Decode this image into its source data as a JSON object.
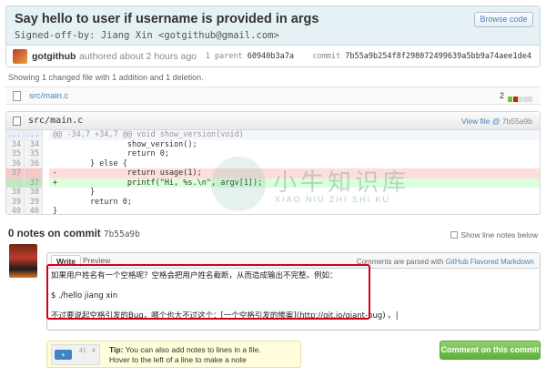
{
  "commit": {
    "title": "Say hello to user if username is provided in args",
    "signoff": "Signed-off-by: Jiang Xin <gotgithub@gmail.com>",
    "browse_code": "Browse code",
    "author": "gotgithub",
    "authored": "authored about 2 hours ago",
    "parent_count": "1 parent",
    "parent_sha": "60940b3a7a",
    "commit_label": "commit",
    "commit_sha": "7b55a9b254f8f298072499639a5bb9a74aee1de4"
  },
  "summary": "Showing 1 changed file with 1 addition and 1 deletion.",
  "toc": {
    "file": "src/main.c",
    "count": "2"
  },
  "diff": {
    "file": "src/main.c",
    "view_file": "View file @",
    "view_sha": "7b55a9b",
    "lines": [
      {
        "type": "hunk",
        "a": "...",
        "b": "...",
        "code": "@@ -34,7 +34,7 @@ void show_version(void)"
      },
      {
        "type": "ctx",
        "a": "34",
        "b": "34",
        "code": "                show_version();"
      },
      {
        "type": "ctx",
        "a": "35",
        "b": "35",
        "code": "                return 0;"
      },
      {
        "type": "ctx",
        "a": "36",
        "b": "36",
        "code": "        } else {"
      },
      {
        "type": "del",
        "a": "37",
        "b": "",
        "code": "-               return usage(1);"
      },
      {
        "type": "add",
        "a": "",
        "b": "37",
        "code": "+               printf(\"Hi, %s.\\n\", argv[1]);"
      },
      {
        "type": "ctx",
        "a": "38",
        "b": "38",
        "code": "        }"
      },
      {
        "type": "ctx",
        "a": "39",
        "b": "39",
        "code": "        return 0;"
      },
      {
        "type": "ctx",
        "a": "40",
        "b": "40",
        "code": "}"
      }
    ]
  },
  "watermark": {
    "text": "小牛知识库",
    "sub": "XIAO NIU ZHI SHI KU"
  },
  "notes": {
    "title": "0 notes on commit",
    "sha": "7b55a9b",
    "show_line_notes": "Show line notes below"
  },
  "comment": {
    "tab_write": "Write",
    "tab_preview": "Preview",
    "parsed_prefix": "Comments are parsed with",
    "parsed_link": "GitHub Flavored Markdown",
    "lines": [
      "如果用户姓名有一个空格呢？空格会把用户姓名截断，从而造成输出不完整。例如：",
      "",
      "    $ ./hello jiang xin",
      "",
      "不过要说起空格引发的Bug，哪个也大不过这个：[一个空格引发的惨案](http://git.io/giant-bug) 。|"
    ],
    "button": "Comment on this commit"
  },
  "tip": {
    "label": "Tip:",
    "text1": "You can also add notes to lines in a file.",
    "text2": "Hover to the left of a line to make a note",
    "num_a": "41",
    "num_b": "4"
  }
}
